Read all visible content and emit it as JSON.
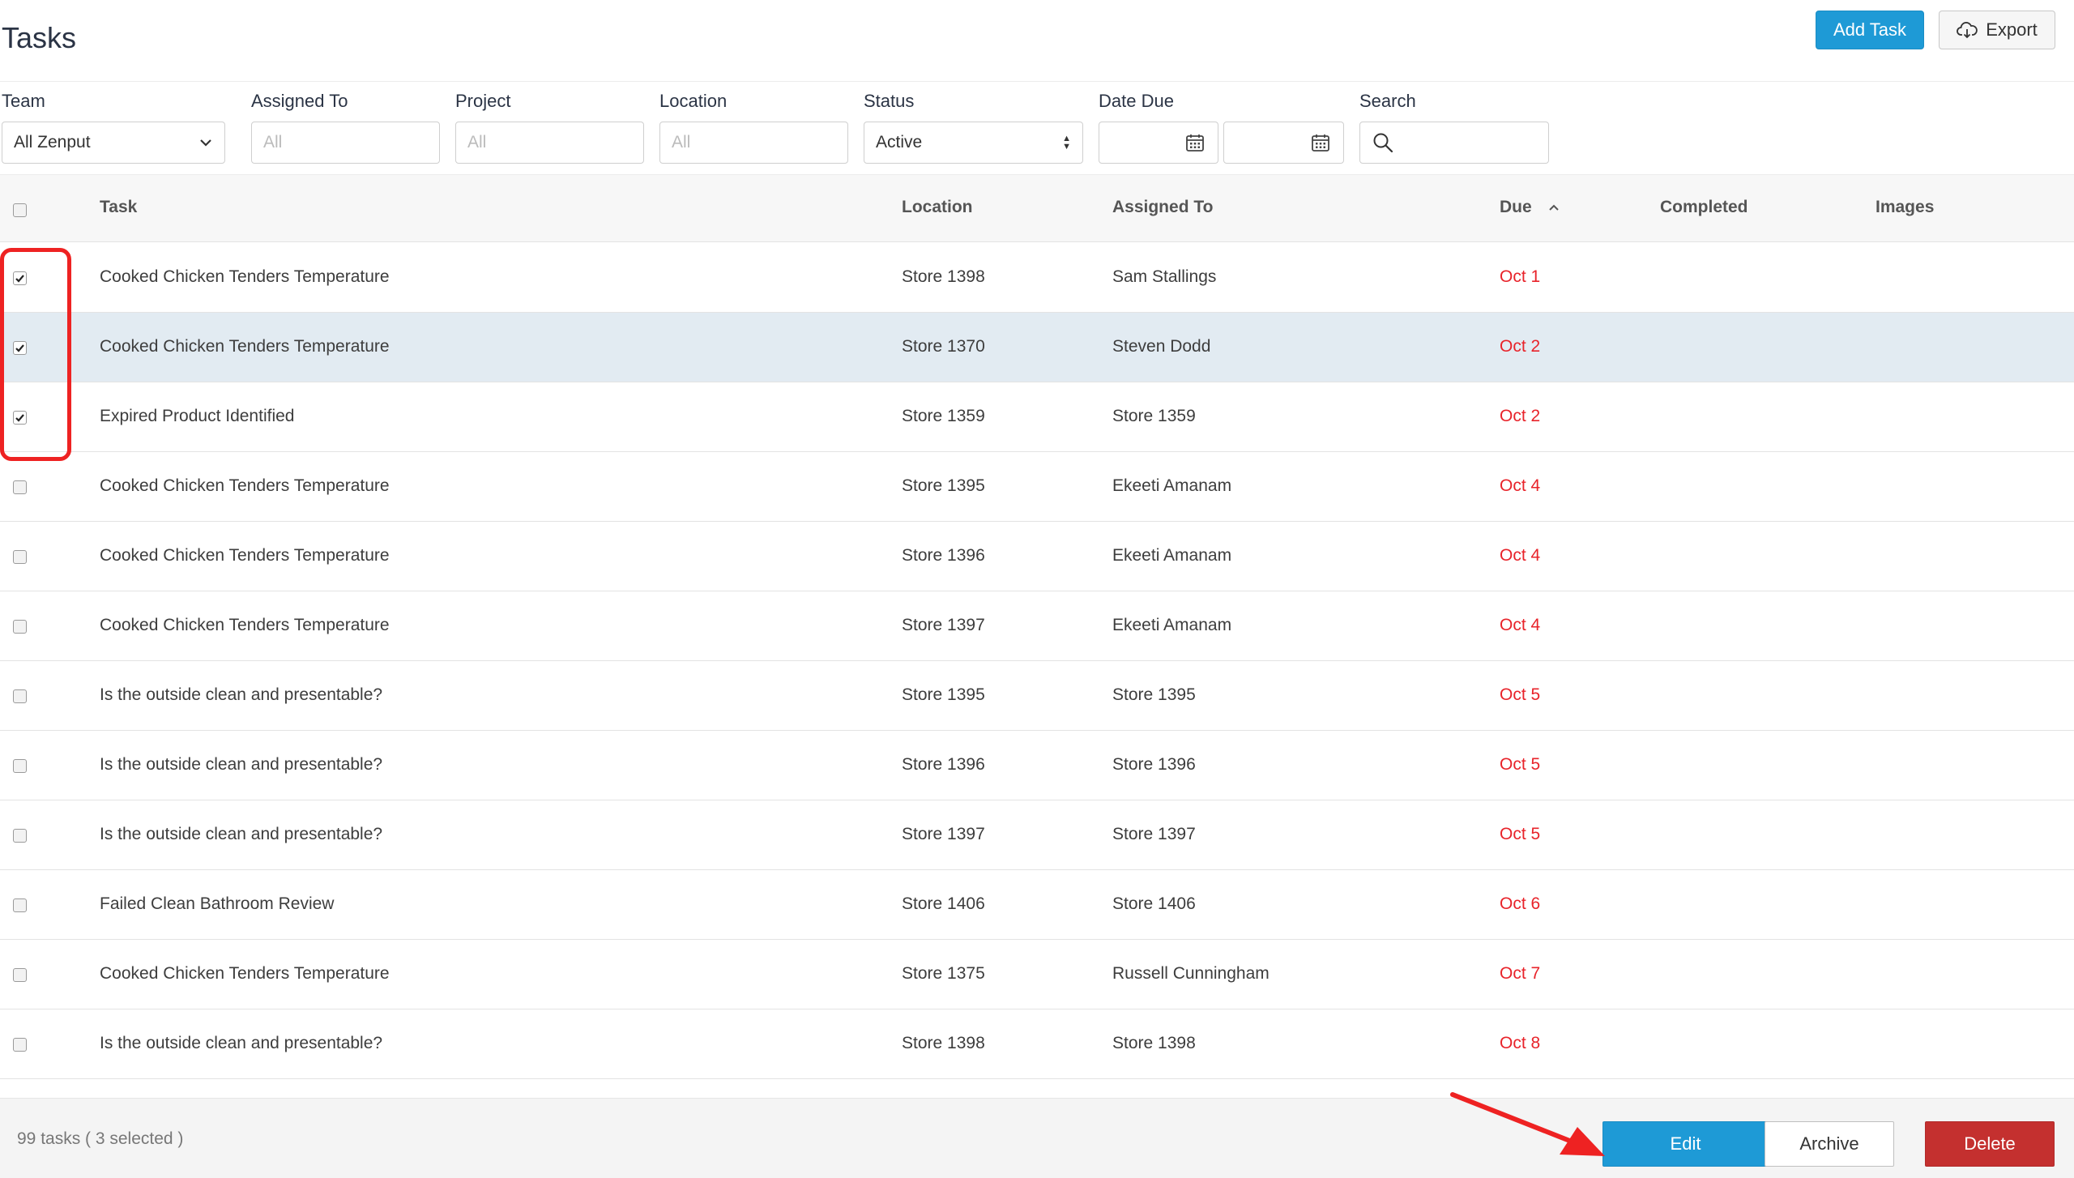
{
  "page": {
    "title": "Tasks",
    "add_task_label": "Add Task",
    "export_label": "Export"
  },
  "filters": {
    "team": {
      "label": "Team",
      "value": "All Zenput"
    },
    "assigned_to": {
      "label": "Assigned To",
      "placeholder": "All"
    },
    "project": {
      "label": "Project",
      "placeholder": "All"
    },
    "location": {
      "label": "Location",
      "placeholder": "All"
    },
    "status": {
      "label": "Status",
      "value": "Active"
    },
    "date_due": {
      "label": "Date Due"
    },
    "search": {
      "label": "Search"
    }
  },
  "table": {
    "columns": {
      "task": "Task",
      "location": "Location",
      "assigned_to": "Assigned To",
      "due": "Due",
      "completed": "Completed",
      "images": "Images"
    },
    "sort": {
      "column": "due",
      "direction": "asc",
      "icon": "caret-up-icon"
    },
    "rows": [
      {
        "task": "Cooked Chicken Tenders Temperature",
        "location": "Store 1398",
        "assigned_to": "Sam Stallings",
        "due": "Oct 1",
        "checked": true,
        "highlight": false
      },
      {
        "task": "Cooked Chicken Tenders Temperature",
        "location": "Store 1370",
        "assigned_to": "Steven Dodd",
        "due": "Oct 2",
        "checked": true,
        "highlight": true
      },
      {
        "task": "Expired Product Identified",
        "location": "Store 1359",
        "assigned_to": "Store 1359",
        "due": "Oct 2",
        "checked": true,
        "highlight": false
      },
      {
        "task": "Cooked Chicken Tenders Temperature",
        "location": "Store 1395",
        "assigned_to": "Ekeeti Amanam",
        "due": "Oct 4",
        "checked": false,
        "highlight": false
      },
      {
        "task": "Cooked Chicken Tenders Temperature",
        "location": "Store 1396",
        "assigned_to": "Ekeeti Amanam",
        "due": "Oct 4",
        "checked": false,
        "highlight": false
      },
      {
        "task": "Cooked Chicken Tenders Temperature",
        "location": "Store 1397",
        "assigned_to": "Ekeeti Amanam",
        "due": "Oct 4",
        "checked": false,
        "highlight": false
      },
      {
        "task": "Is the outside clean and presentable?",
        "location": "Store 1395",
        "assigned_to": "Store 1395",
        "due": "Oct 5",
        "checked": false,
        "highlight": false
      },
      {
        "task": "Is the outside clean and presentable?",
        "location": "Store 1396",
        "assigned_to": "Store 1396",
        "due": "Oct 5",
        "checked": false,
        "highlight": false
      },
      {
        "task": "Is the outside clean and presentable?",
        "location": "Store 1397",
        "assigned_to": "Store 1397",
        "due": "Oct 5",
        "checked": false,
        "highlight": false
      },
      {
        "task": "Failed Clean Bathroom Review",
        "location": "Store 1406",
        "assigned_to": "Store 1406",
        "due": "Oct 6",
        "checked": false,
        "highlight": false
      },
      {
        "task": "Cooked Chicken Tenders Temperature",
        "location": "Store 1375",
        "assigned_to": "Russell Cunningham",
        "due": "Oct 7",
        "checked": false,
        "highlight": false
      },
      {
        "task": "Is the outside clean and presentable?",
        "location": "Store 1398",
        "assigned_to": "Store 1398",
        "due": "Oct 8",
        "checked": false,
        "highlight": false
      }
    ]
  },
  "footer": {
    "count_text": "99 tasks ( 3 selected )",
    "edit_label": "Edit",
    "archive_label": "Archive",
    "delete_label": "Delete"
  },
  "colors": {
    "primary": "#1e9ad6",
    "danger": "#c4302f",
    "due_overdue": "#e8232a",
    "row_highlight": "#e2ebf2",
    "annotation": "#ee2222"
  },
  "icons": [
    "export-cloud-icon",
    "chevron-down-icon",
    "select-arrows-icon",
    "calendar-icon",
    "search-icon",
    "caret-up-icon",
    "checkmark-icon",
    "annotation-arrow-icon"
  ]
}
